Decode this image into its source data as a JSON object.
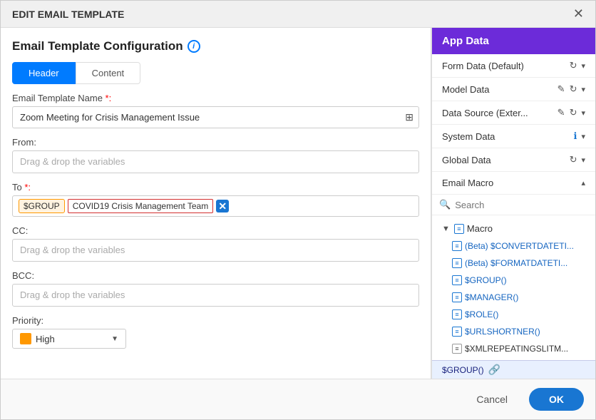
{
  "modal": {
    "title": "EDIT EMAIL TEMPLATE",
    "close_label": "✕"
  },
  "left_panel": {
    "title": "Email Template Configuration",
    "info_icon": "i",
    "tabs": [
      {
        "label": "Header",
        "active": true
      },
      {
        "label": "Content",
        "active": false
      }
    ],
    "fields": {
      "email_template_name": {
        "label": "Email Template Name",
        "required": true,
        "value": "Zoom Meeting for Crisis Management Issue",
        "icon": "⊞"
      },
      "from": {
        "label": "From:",
        "placeholder": "Drag & drop the variables"
      },
      "to": {
        "label": "To",
        "required": true,
        "tag_group": "$GROUP",
        "tag_text": "COVID19 Crisis Management Team",
        "placeholder": ""
      },
      "cc": {
        "label": "CC:",
        "placeholder": "Drag & drop the variables"
      },
      "bcc": {
        "label": "BCC:",
        "placeholder": "Drag & drop the variables"
      },
      "priority": {
        "label": "Priority:",
        "value": "High"
      }
    }
  },
  "right_panel": {
    "title": "App Data",
    "items": [
      {
        "label": "Form Data (Default)",
        "has_refresh": true,
        "has_chevron": true
      },
      {
        "label": "Model Data",
        "has_edit": true,
        "has_refresh": true,
        "has_chevron": true
      },
      {
        "label": "Data Source (Exter...",
        "has_edit": true,
        "has_refresh": true,
        "has_chevron": true
      },
      {
        "label": "System Data",
        "has_info": true,
        "has_chevron": true
      },
      {
        "label": "Global Data",
        "has_refresh": true,
        "has_chevron": true
      },
      {
        "label": "Email Macro",
        "has_chevron_up": true
      }
    ],
    "search_placeholder": "Search",
    "macro": {
      "parent": "Macro",
      "children": [
        {
          "label": "(Beta) $CONVERTDATETI...",
          "color": "blue"
        },
        {
          "label": "(Beta) $FORMATDATETI...",
          "color": "blue"
        },
        {
          "label": "$GROUP()",
          "color": "blue"
        },
        {
          "label": "$MANAGER()",
          "color": "blue"
        },
        {
          "label": "$ROLE()",
          "color": "blue"
        },
        {
          "label": "$URLSHORTNER()",
          "color": "blue"
        },
        {
          "label": "$XMLREPEATINGSLITM...",
          "color": "normal"
        }
      ]
    },
    "bottom_bar": {
      "label": "$GROUP()",
      "link_icon": "🔗"
    }
  },
  "footer": {
    "cancel_label": "Cancel",
    "ok_label": "OK"
  }
}
